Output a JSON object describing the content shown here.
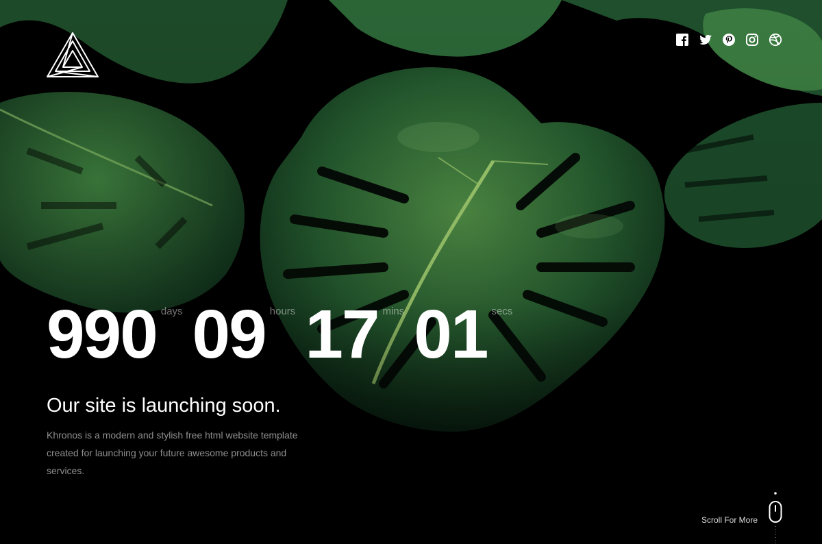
{
  "site": {
    "logo": "triangle-logo"
  },
  "social": [
    {
      "name": "facebook",
      "icon": "facebook-icon"
    },
    {
      "name": "twitter",
      "icon": "twitter-icon"
    },
    {
      "name": "pinterest",
      "icon": "pinterest-icon"
    },
    {
      "name": "instagram",
      "icon": "instagram-icon"
    },
    {
      "name": "dribbble",
      "icon": "dribbble-icon"
    }
  ],
  "countdown": {
    "days": {
      "value": "990",
      "label": "days"
    },
    "hours": {
      "value": "09",
      "label": "hours"
    },
    "mins": {
      "value": "17",
      "label": "mins"
    },
    "secs": {
      "value": "01",
      "label": "secs"
    }
  },
  "headline": "Our site is launching soon.",
  "description": "Khronos is a modern and stylish free html website template created for launching your future awesome products and services.",
  "scroll": {
    "label": "Scroll For More"
  },
  "colors": {
    "background": "#000000",
    "leaf_dark": "#0f2e1a",
    "leaf_mid": "#2c6b3a",
    "leaf_light": "#5f9e52",
    "text": "#ffffff"
  }
}
